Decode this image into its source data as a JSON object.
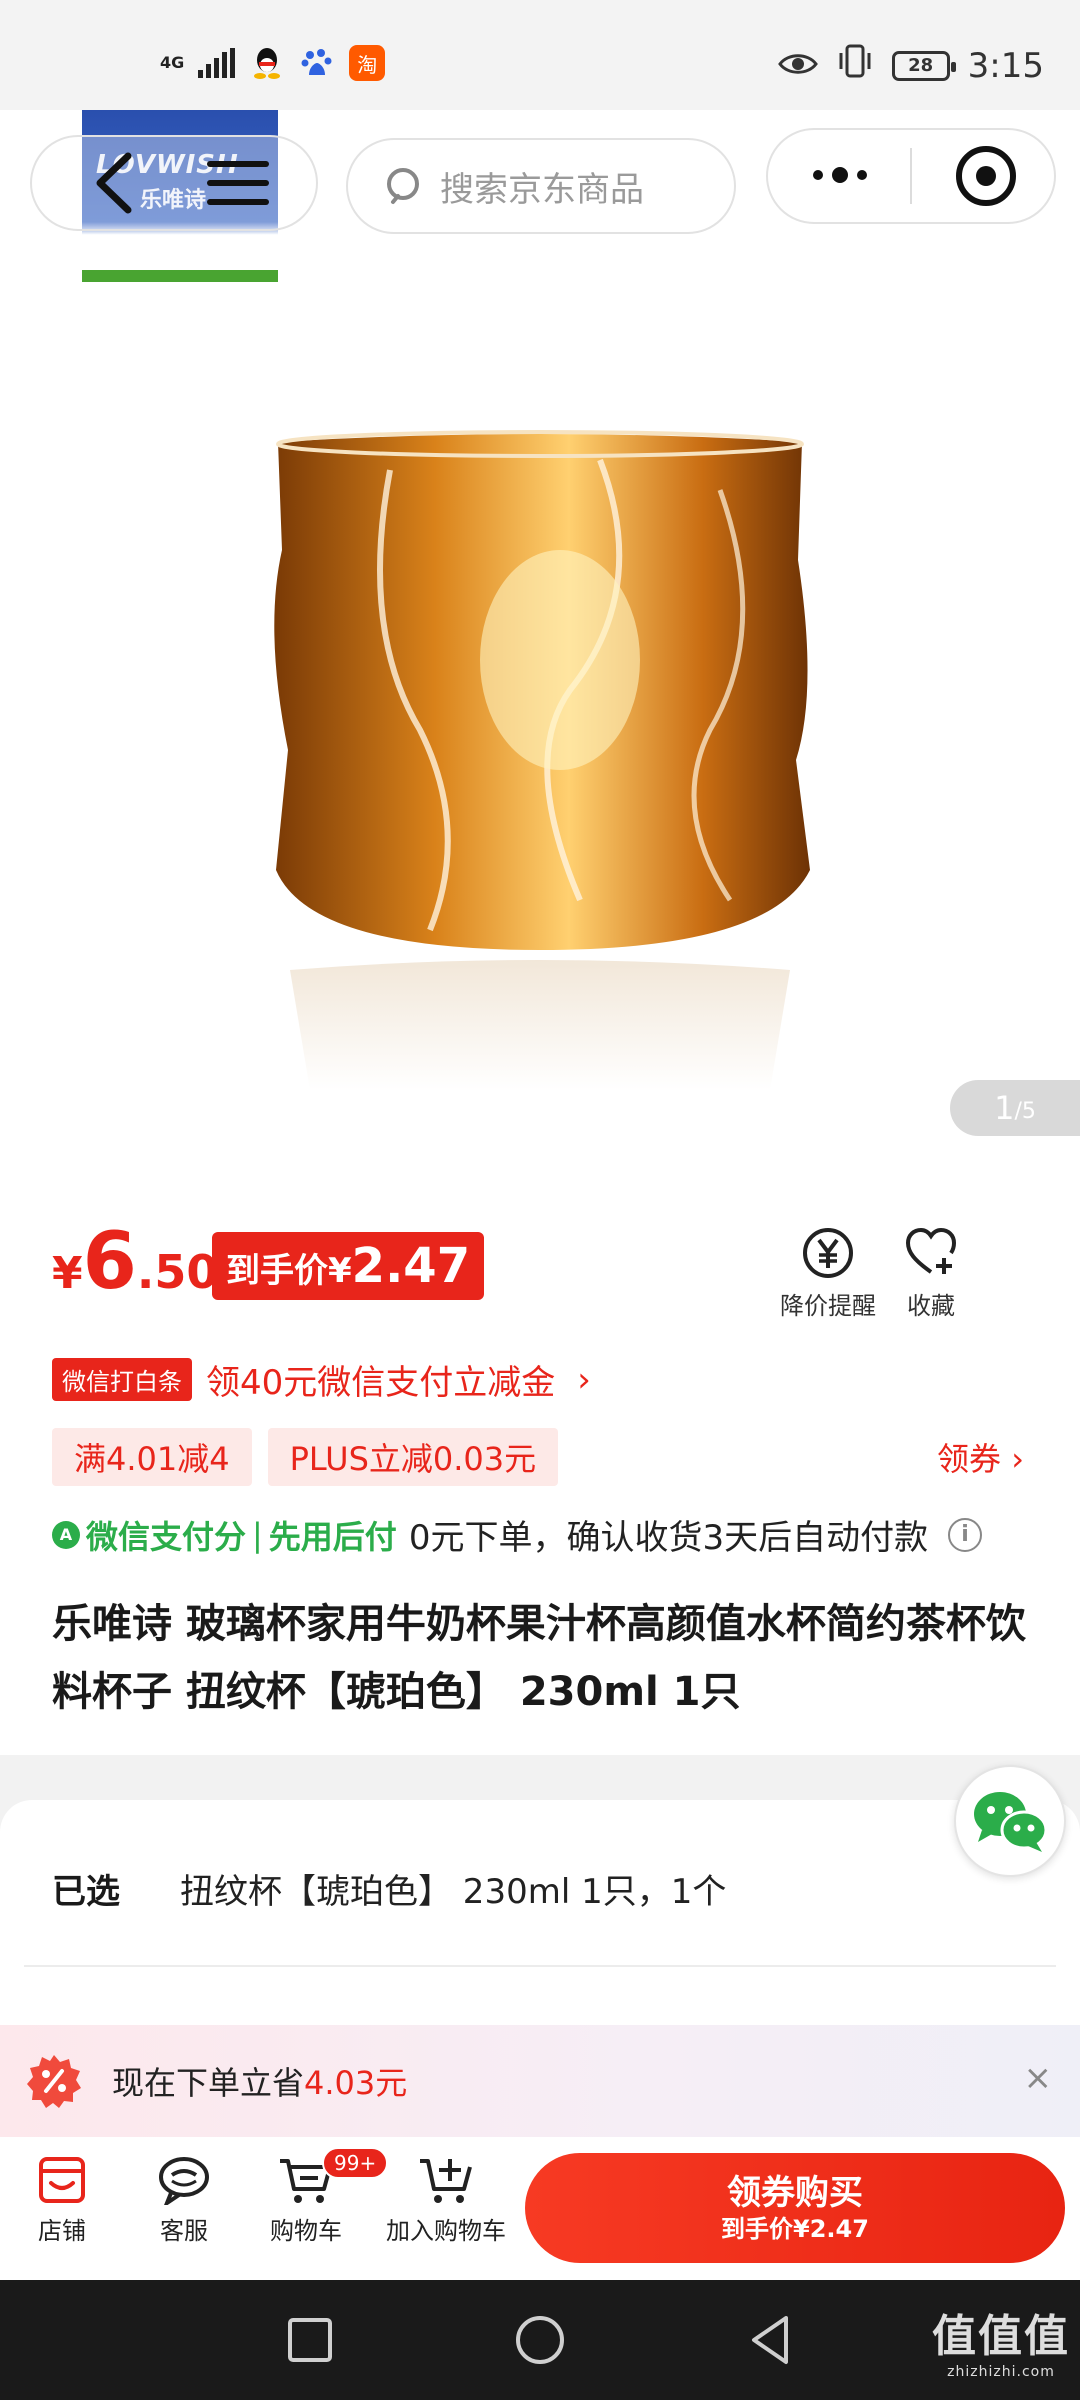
{
  "status_bar": {
    "network": "4G",
    "taobao_glyph": "淘",
    "time": "3:15",
    "battery": "28"
  },
  "nav": {
    "brand_logo_text": "LOVWISH",
    "brand_logo_cn": "乐唯诗",
    "search_placeholder": "搜索京东商品"
  },
  "gallery": {
    "current": "1",
    "total": "/5"
  },
  "price": {
    "currency": "¥",
    "integer": "6",
    "decimal": ".50",
    "final_label": "到手价¥",
    "final_value": "2.47"
  },
  "actions": {
    "price_alert": "降价提醒",
    "favorite": "收藏"
  },
  "wechat_promo": {
    "tag": "微信打白条",
    "text": "领40元微信支付立减金",
    "arrow": "›"
  },
  "coupons": [
    "满4.01减4",
    "PLUS立减0.03元"
  ],
  "claim_coupon": "领券 ›",
  "pay_later": {
    "brand": "微信支付分",
    "separator": "|",
    "mode": "先用后付",
    "desc": "0元下单，确认收货3天后自动付款",
    "info_glyph": "i"
  },
  "product_title": "乐唯诗 玻璃杯家用牛奶杯果汁杯高颜值水杯简约茶杯饮料杯子 扭纹杯【琥珀色】 230ml 1只",
  "selection": {
    "label": "已选",
    "value": "扭纹杯【琥珀色】 230ml 1只，1个"
  },
  "promo_banner": {
    "text": "现在下单立省",
    "amount": "4.03元",
    "close": "×"
  },
  "bottom_bar": {
    "store": "店铺",
    "service": "客服",
    "cart": "购物车",
    "cart_badge": "99+",
    "add_cart": "加入购物车",
    "buy_main": "领券购买",
    "buy_sub": "到手价¥2.47"
  },
  "watermark": {
    "line1": "值值值",
    "line2": "zhizhizhi.com"
  },
  "colors": {
    "accent_red": "#e8251b",
    "wechat_green": "#2bad4a",
    "system_nav": "#1a1a1a"
  },
  "icons": [
    "back-icon",
    "menu-icon",
    "search-icon",
    "more-icon",
    "target-icon",
    "yen-bell-icon",
    "heart-plus-icon",
    "wechat-chat-icon",
    "percent-badge-icon",
    "store-icon",
    "service-icon",
    "cart-icon",
    "add-cart-icon",
    "square-nav-icon",
    "circle-nav-icon",
    "triangle-back-icon"
  ]
}
